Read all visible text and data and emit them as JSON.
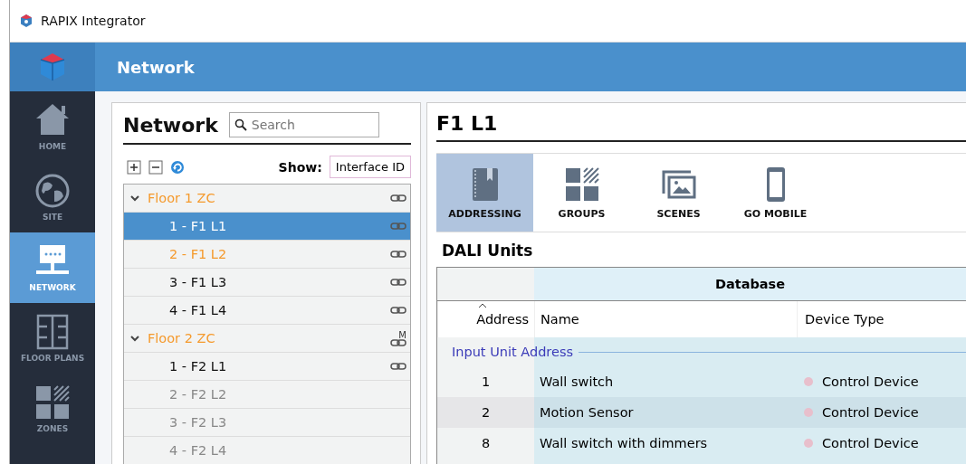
{
  "window": {
    "title": "RAPIX Integrator"
  },
  "header": {
    "title": "Network"
  },
  "sidebar": {
    "items": [
      {
        "label": "HOME",
        "selected": false
      },
      {
        "label": "SITE",
        "selected": false
      },
      {
        "label": "NETWORK",
        "selected": true
      },
      {
        "label": "FLOOR PLANS",
        "selected": false
      },
      {
        "label": "ZONES",
        "selected": false
      }
    ]
  },
  "network_panel": {
    "title": "Network",
    "search": {
      "placeholder": "Search"
    },
    "show_label": "Show:",
    "show_value": "Interface ID",
    "tree": [
      {
        "label": "Floor 1 ZC",
        "expanded": true,
        "linked": true,
        "highlighted": true,
        "inactive": false,
        "selected": false,
        "children": [
          {
            "label": "1 - F1 L1",
            "linked": true,
            "highlighted": false,
            "inactive": false,
            "selected": true
          },
          {
            "label": "2 - F1 L2",
            "linked": true,
            "highlighted": true,
            "inactive": false,
            "selected": false
          },
          {
            "label": "3 - F1 L3",
            "linked": true,
            "highlighted": false,
            "inactive": false,
            "selected": false
          },
          {
            "label": "4 - F1 L4",
            "linked": true,
            "highlighted": false,
            "inactive": false,
            "selected": false
          }
        ]
      },
      {
        "label": "Floor 2 ZC",
        "expanded": true,
        "linked": true,
        "link_mark": "M",
        "highlighted": true,
        "inactive": false,
        "selected": false,
        "children": [
          {
            "label": "1 - F2 L1",
            "linked": true,
            "highlighted": false,
            "inactive": false,
            "selected": false
          },
          {
            "label": "2 - F2 L2",
            "linked": false,
            "highlighted": false,
            "inactive": true,
            "selected": false
          },
          {
            "label": "3 - F2 L3",
            "linked": false,
            "highlighted": false,
            "inactive": true,
            "selected": false
          },
          {
            "label": "4 - F2 L4",
            "linked": false,
            "highlighted": false,
            "inactive": true,
            "selected": false
          }
        ]
      }
    ]
  },
  "detail_panel": {
    "title": "F1 L1",
    "tabs": [
      {
        "label": "ADDRESSING",
        "selected": true
      },
      {
        "label": "GROUPS",
        "selected": false
      },
      {
        "label": "SCENES",
        "selected": false
      },
      {
        "label": "GO MOBILE",
        "selected": false
      }
    ],
    "section_title": "DALI Units",
    "table": {
      "group_header": "Database",
      "columns": [
        "Address",
        "Name",
        "Device Type"
      ],
      "group_row": "Input Unit Address",
      "rows": [
        {
          "address": "1",
          "name": "Wall switch",
          "device_type": "Control Device",
          "color": "#e8bfcc",
          "selected": false
        },
        {
          "address": "2",
          "name": "Motion Sensor",
          "device_type": "Control Device",
          "color": "#e8bfcc",
          "selected": true
        },
        {
          "address": "8",
          "name": "Wall switch with dimmers",
          "device_type": "Control Device",
          "color": "#e8bfcc",
          "selected": false
        }
      ]
    }
  }
}
